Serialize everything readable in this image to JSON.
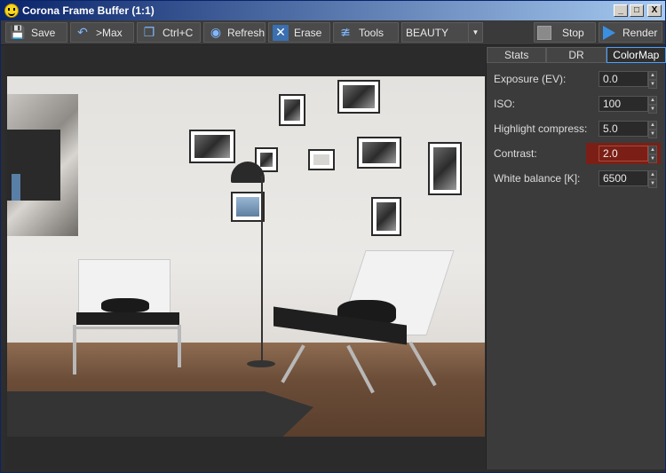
{
  "window": {
    "title": "Corona Frame Buffer (1:1)"
  },
  "titlebar": {
    "minimize": "_",
    "maximize": "□",
    "close": "X"
  },
  "toolbar": {
    "save_label": "Save",
    "max_label": ">Max",
    "copy_label": "Ctrl+C",
    "refresh_label": "Refresh",
    "erase_label": "Erase",
    "tools_label": "Tools",
    "pass_selected": "BEAUTY",
    "stop_label": "Stop",
    "render_label": "Render"
  },
  "panel": {
    "tabs": [
      {
        "label": "Stats"
      },
      {
        "label": "DR"
      },
      {
        "label": "ColorMap"
      }
    ],
    "active_tab": "ColorMap",
    "settings": [
      {
        "label": "Exposure (EV):",
        "value": "0.0"
      },
      {
        "label": "ISO:",
        "value": "100"
      },
      {
        "label": "Highlight compress:",
        "value": "5.0"
      },
      {
        "label": "Contrast:",
        "value": "2.0"
      },
      {
        "label": "White balance [K]:",
        "value": "6500"
      }
    ]
  },
  "colors": {
    "accent": "#4da0ff",
    "highlight": "#7b1f16",
    "panel_bg": "#3b3b3b"
  }
}
